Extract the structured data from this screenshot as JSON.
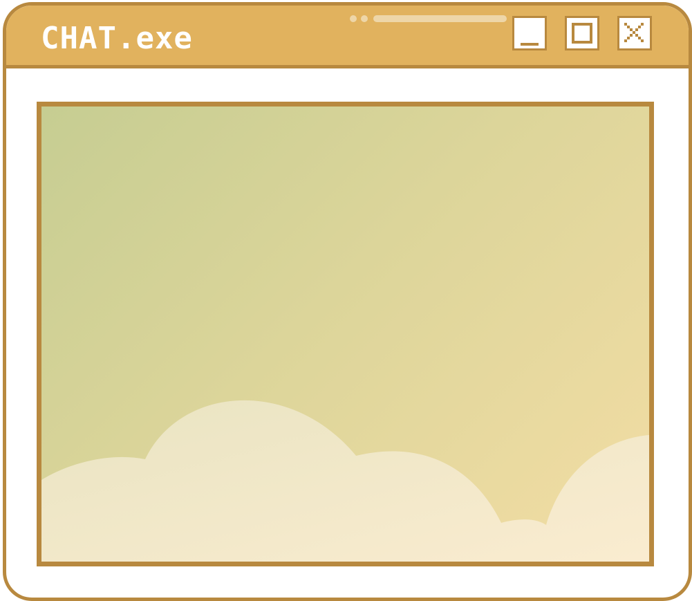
{
  "window": {
    "title": "CHAT.exe",
    "colors": {
      "titlebar": "#e1b25e",
      "border": "#b8893f",
      "frame": "#ffffff",
      "content_gradient_start": "#c6cd92",
      "content_gradient_end": "#f3dda4",
      "clouds": "#f2e8c6"
    }
  },
  "controls": {
    "minimize_icon": "minimize-icon",
    "maximize_icon": "maximize-icon",
    "close_icon": "close-icon"
  }
}
